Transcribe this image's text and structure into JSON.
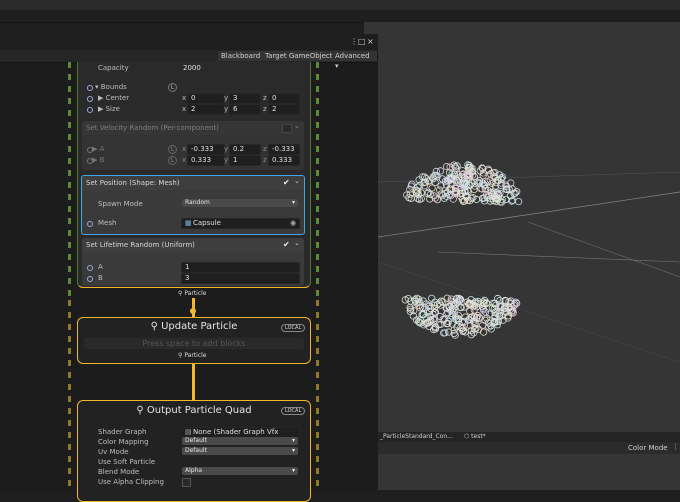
{
  "toolbar": {
    "blackboard": "Blackboard",
    "target": "Target GameObject",
    "advanced": "Advanced"
  },
  "init": {
    "capacity_label": "Capacity",
    "capacity_value": "2000",
    "bounds_label": "Bounds",
    "center_label": "Center",
    "size_label": "Size",
    "center": {
      "x": "0",
      "y": "3",
      "z": "0"
    },
    "size": {
      "x": "2",
      "y": "6",
      "z": "2"
    }
  },
  "velocity_block": {
    "title": "Set Velocity Random (Per-component)",
    "a_label": "A",
    "b_label": "B",
    "a": {
      "x": "-0.333",
      "y": "0.2",
      "z": "-0.333"
    },
    "b": {
      "x": "0.333",
      "y": "1",
      "z": "0.333"
    }
  },
  "position_block": {
    "title": "Set Position (Shape: Mesh)",
    "spawn_label": "Spawn Mode",
    "spawn_value": "Random",
    "mesh_label": "Mesh",
    "mesh_value": "Capsule"
  },
  "lifetime_block": {
    "title": "Set Lifetime Random (Uniform)",
    "a_label": "A",
    "b_label": "B",
    "a_value": "1",
    "b_value": "3"
  },
  "axis": {
    "x": "x",
    "y": "y",
    "z": "z"
  },
  "particle_label": "Particle",
  "update": {
    "title": "Update Particle",
    "badge": "LOCAL",
    "placeholder": "Press space to add blocks",
    "out_label": "Particle"
  },
  "output": {
    "title": "Output Particle Quad",
    "badge": "LOCAL",
    "shader_label": "Shader Graph",
    "shader_value": "None (Shader Graph Vfx Asset)",
    "color_mapping_label": "Color Mapping",
    "color_mapping_value": "Default",
    "uv_label": "Uv Mode",
    "uv_value": "Default",
    "soft_label": "Use Soft Particle",
    "blend_label": "Blend Mode",
    "blend_value": "Alpha",
    "clip_label": "Use Alpha Clipping"
  },
  "scene": {
    "tab1": "_ParticleStandard_Con...",
    "tab2": "test*",
    "color_mode": "Color Mode"
  },
  "colors": {
    "accent_yellow": "#f2b72c",
    "selection_blue": "#3fa7e6",
    "init_green": "#5f8a3a"
  }
}
